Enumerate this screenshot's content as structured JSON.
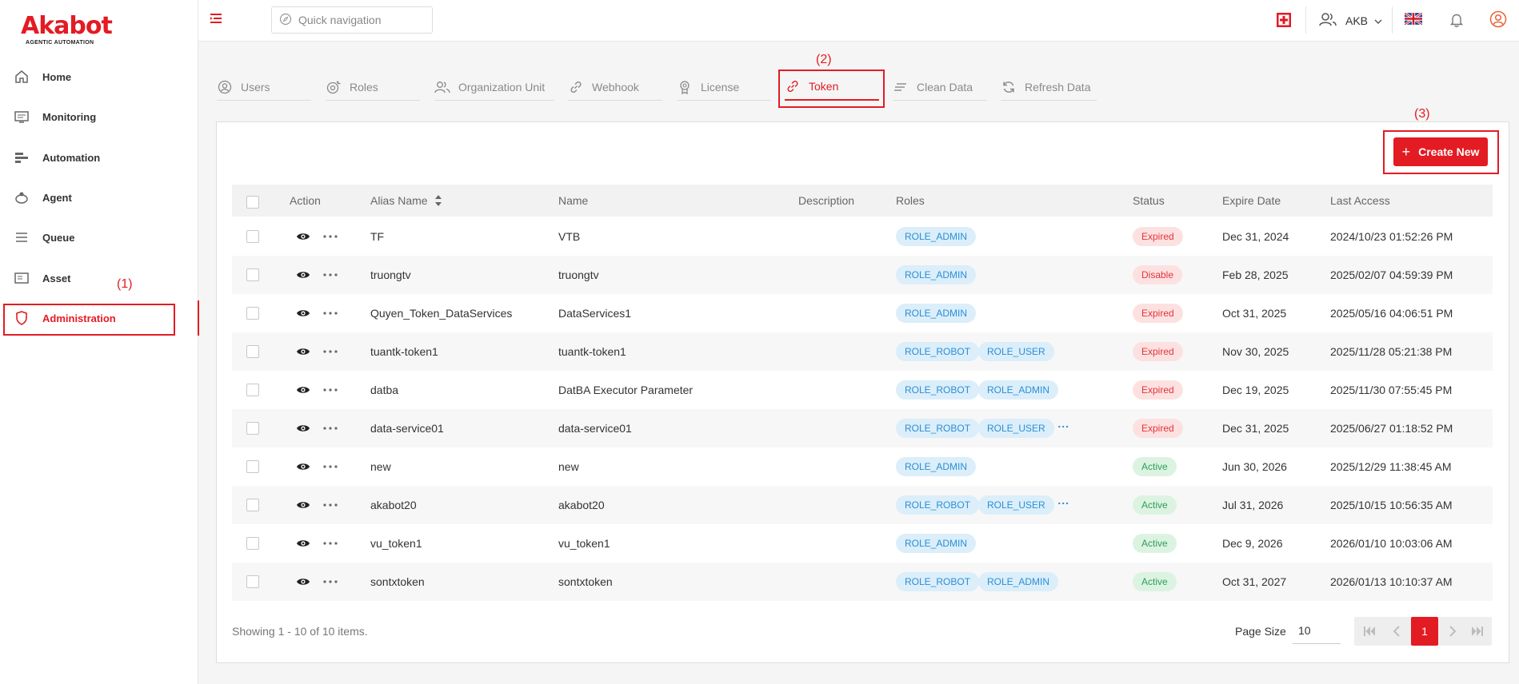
{
  "brand": {
    "name": "Akabot",
    "tagline": "AGENTIC AUTOMATION"
  },
  "sidebar": {
    "items": [
      {
        "label": "Home",
        "icon": "home-icon"
      },
      {
        "label": "Monitoring",
        "icon": "monitor-icon"
      },
      {
        "label": "Automation",
        "icon": "automation-icon"
      },
      {
        "label": "Agent",
        "icon": "agent-icon"
      },
      {
        "label": "Queue",
        "icon": "queue-icon"
      },
      {
        "label": "Asset",
        "icon": "asset-icon"
      },
      {
        "label": "Administration",
        "icon": "shield-icon",
        "active": true
      }
    ]
  },
  "annotations": {
    "sidebar": "(1)",
    "tab": "(2)",
    "create": "(3)"
  },
  "topbar": {
    "search_placeholder": "Quick navigation",
    "user_initials": "AKB",
    "language": "en-GB"
  },
  "tabs": [
    {
      "label": "Users",
      "icon": "user-icon"
    },
    {
      "label": "Roles",
      "icon": "roles-icon"
    },
    {
      "label": "Organization Unit",
      "icon": "org-unit-icon"
    },
    {
      "label": "Webhook",
      "icon": "link-icon"
    },
    {
      "label": "License",
      "icon": "license-icon"
    },
    {
      "label": "Token",
      "icon": "link-icon",
      "active": true
    },
    {
      "label": "Clean Data",
      "icon": "clean-icon"
    },
    {
      "label": "Refresh Data",
      "icon": "refresh-icon"
    }
  ],
  "create_button": "Create New",
  "table": {
    "headers": {
      "action": "Action",
      "alias": "Alias Name",
      "name": "Name",
      "description": "Description",
      "roles": "Roles",
      "status": "Status",
      "expire": "Expire Date",
      "last_access": "Last Access"
    },
    "rows": [
      {
        "alias": "TF",
        "name": "VTB",
        "description": "",
        "roles": [
          "ROLE_ADMIN"
        ],
        "more_roles": false,
        "status": "Expired",
        "expire": "Dec 31, 2024",
        "last_access": "2024/10/23 01:52:26 PM"
      },
      {
        "alias": "truongtv",
        "name": "truongtv",
        "description": "",
        "roles": [
          "ROLE_ADMIN"
        ],
        "more_roles": false,
        "status": "Disable",
        "expire": "Feb 28, 2025",
        "last_access": "2025/02/07 04:59:39 PM"
      },
      {
        "alias": "Quyen_Token_DataServices",
        "name": "DataServices1",
        "description": "",
        "roles": [
          "ROLE_ADMIN"
        ],
        "more_roles": false,
        "status": "Expired",
        "expire": "Oct 31, 2025",
        "last_access": "2025/05/16 04:06:51 PM"
      },
      {
        "alias": "tuantk-token1",
        "name": "tuantk-token1",
        "description": "",
        "roles": [
          "ROLE_ROBOT",
          "ROLE_USER"
        ],
        "more_roles": false,
        "status": "Expired",
        "expire": "Nov 30, 2025",
        "last_access": "2025/11/28 05:21:38 PM"
      },
      {
        "alias": "datba",
        "name": "DatBA Executor Parameter",
        "description": "",
        "roles": [
          "ROLE_ROBOT",
          "ROLE_ADMIN"
        ],
        "more_roles": false,
        "status": "Expired",
        "expire": "Dec 19, 2025",
        "last_access": "2025/11/30 07:55:45 PM"
      },
      {
        "alias": "data-service01",
        "name": "data-service01",
        "description": "",
        "roles": [
          "ROLE_ROBOT",
          "ROLE_USER"
        ],
        "more_roles": true,
        "status": "Expired",
        "expire": "Dec 31, 2025",
        "last_access": "2025/06/27 01:18:52 PM"
      },
      {
        "alias": "new",
        "name": "new",
        "description": "",
        "roles": [
          "ROLE_ADMIN"
        ],
        "more_roles": false,
        "status": "Active",
        "expire": "Jun 30, 2026",
        "last_access": "2025/12/29 11:38:45 AM"
      },
      {
        "alias": "akabot20",
        "name": "akabot20",
        "description": "",
        "roles": [
          "ROLE_ROBOT",
          "ROLE_USER"
        ],
        "more_roles": true,
        "status": "Active",
        "expire": "Jul 31, 2026",
        "last_access": "2025/10/15 10:56:35 AM"
      },
      {
        "alias": "vu_token1",
        "name": "vu_token1",
        "description": "",
        "roles": [
          "ROLE_ADMIN"
        ],
        "more_roles": false,
        "status": "Active",
        "expire": "Dec 9, 2026",
        "last_access": "2026/01/10 10:03:06 AM"
      },
      {
        "alias": "sontxtoken",
        "name": "sontxtoken",
        "description": "",
        "roles": [
          "ROLE_ROBOT",
          "ROLE_ADMIN"
        ],
        "more_roles": false,
        "status": "Active",
        "expire": "Oct 31, 2027",
        "last_access": "2026/01/13 10:10:37 AM"
      }
    ]
  },
  "footer": {
    "showing": "Showing 1 - 10 of 10 items.",
    "page_size_label": "Page Size",
    "page_size": "10",
    "current_page": "1"
  },
  "colors": {
    "accent": "#e31b23",
    "role_bg": "#dbeefa",
    "role_text": "#2b8fd6",
    "expired_bg": "#fde1e1",
    "active_bg": "#dcf3e2"
  }
}
